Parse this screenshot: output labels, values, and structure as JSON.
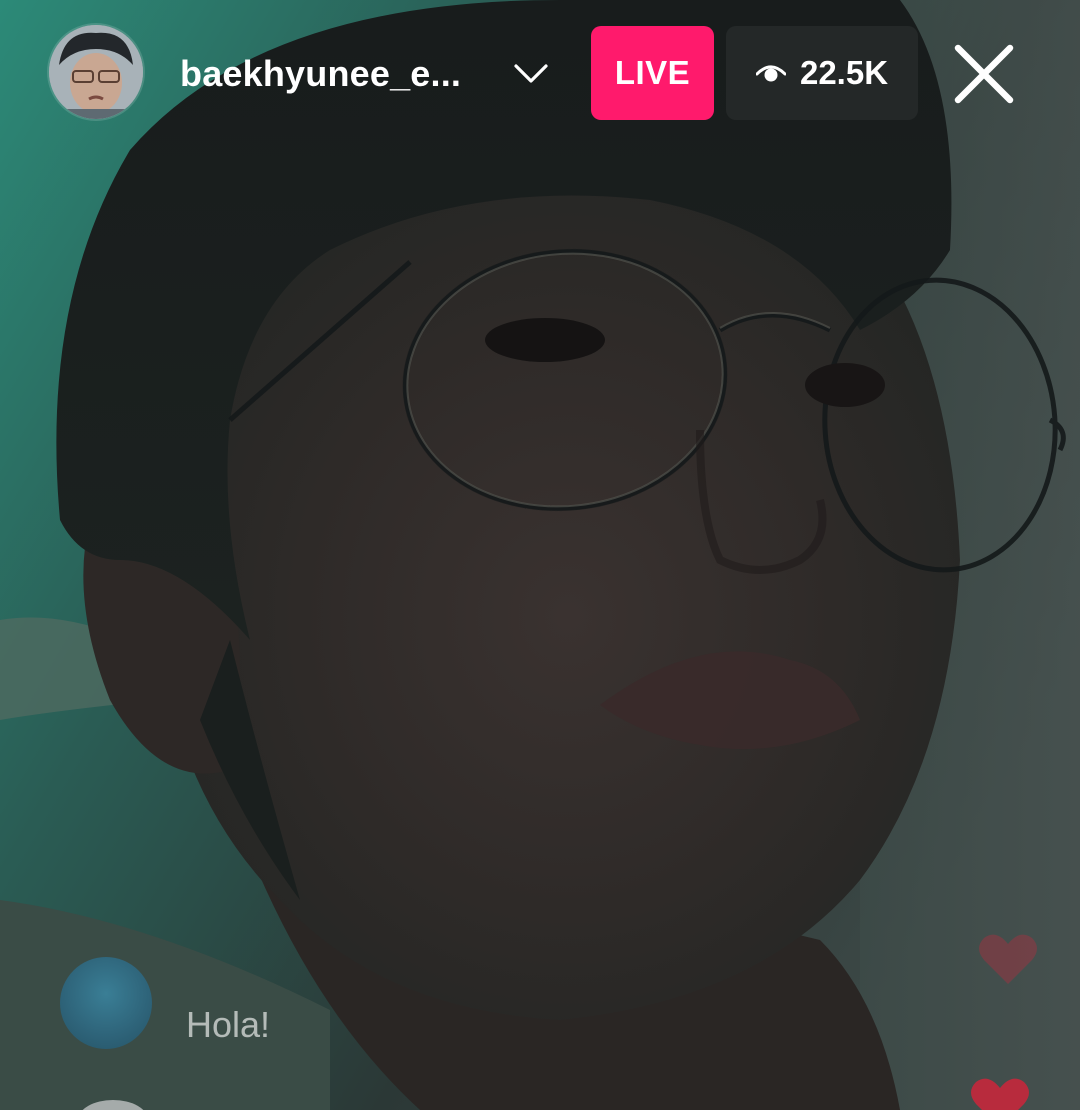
{
  "header": {
    "username": "baekhyunee_e...",
    "live_label": "LIVE",
    "viewer_count": "22.5K",
    "icons": {
      "dropdown": "chevron-down-icon",
      "viewers": "eye-icon",
      "close": "close-icon"
    }
  },
  "comments": [
    {
      "text": "Hola!"
    }
  ],
  "colors": {
    "live_badge": "#ff1a6c",
    "viewer_pill": "#2a2e2e",
    "text": "#ffffff",
    "heart": "#c5283c"
  }
}
